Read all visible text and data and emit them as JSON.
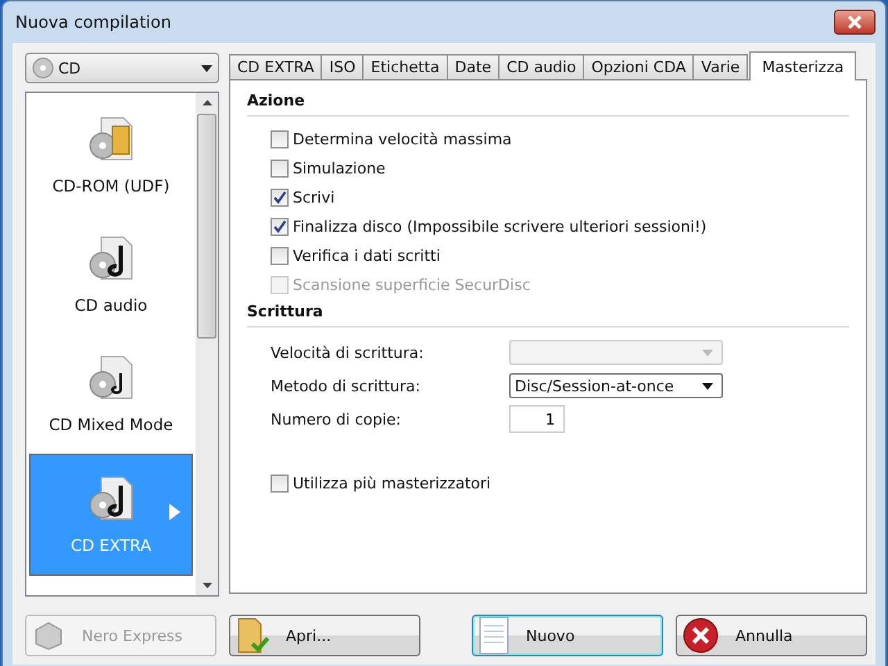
{
  "window": {
    "title": "Nuova compilation"
  },
  "media_dropdown": {
    "value": "CD"
  },
  "compilation_types": [
    {
      "label": "CD-ROM (UDF)",
      "selected": false
    },
    {
      "label": "CD audio",
      "selected": false
    },
    {
      "label": "CD Mixed Mode",
      "selected": false
    },
    {
      "label": "CD EXTRA",
      "selected": true
    }
  ],
  "tabs": [
    {
      "label": "CD EXTRA",
      "selected": false
    },
    {
      "label": "ISO",
      "selected": false
    },
    {
      "label": "Etichetta",
      "selected": false
    },
    {
      "label": "Date",
      "selected": false
    },
    {
      "label": "CD audio",
      "selected": false
    },
    {
      "label": "Opzioni CDA",
      "selected": false
    },
    {
      "label": "Varie",
      "selected": false
    },
    {
      "label": "Masterizza",
      "selected": true
    }
  ],
  "sections": [
    {
      "title": "Azione",
      "items": [
        {
          "kind": "checkbox",
          "label": "Determina velocità massima",
          "checked": false,
          "disabled": false
        },
        {
          "kind": "checkbox",
          "label": "Simulazione",
          "checked": false,
          "disabled": false
        },
        {
          "kind": "checkbox",
          "label": "Scrivi",
          "checked": true,
          "disabled": false
        },
        {
          "kind": "checkbox",
          "label": "Finalizza disco (Impossibile scrivere ulteriori sessioni!)",
          "checked": true,
          "disabled": false
        },
        {
          "kind": "checkbox",
          "label": "Verifica i dati scritti",
          "checked": false,
          "disabled": false
        },
        {
          "kind": "checkbox",
          "label": "Scansione superficie SecurDisc",
          "checked": false,
          "disabled": true
        }
      ]
    },
    {
      "title": "Scrittura",
      "items": [
        {
          "kind": "combo",
          "label": "Velocità di scrittura:",
          "disabled": true
        },
        {
          "kind": "combo",
          "label": "Metodo di scrittura:",
          "value": "Disc/Session-at-once",
          "disabled": false
        },
        {
          "kind": "number",
          "label": "Numero di copie:",
          "value": "1"
        },
        {
          "kind": "spacer"
        },
        {
          "kind": "checkbox",
          "label": "Utilizza più masterizzatori",
          "checked": false,
          "disabled": false
        }
      ]
    }
  ],
  "buttons": [
    {
      "label": "Nero Express",
      "disabled": true,
      "default": false
    },
    {
      "label": "Apri...",
      "disabled": false,
      "default": false
    },
    {
      "label": "Nuovo",
      "disabled": false,
      "default": true
    },
    {
      "label": "Annulla",
      "disabled": false,
      "default": false
    }
  ]
}
